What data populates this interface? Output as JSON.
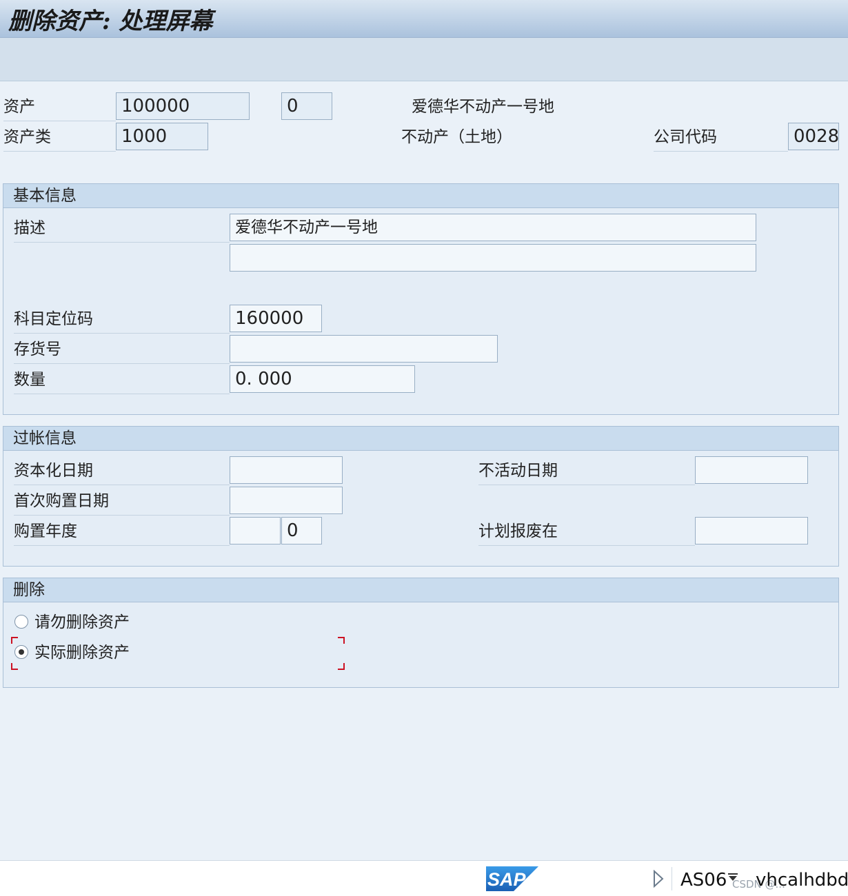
{
  "window": {
    "title": "删除资产: 处理屏幕"
  },
  "header": {
    "asset_label": "资产",
    "asset_number": "100000",
    "asset_subnumber": "0",
    "asset_description": "爱德华不动产一号地",
    "asset_class_label": "资产类",
    "asset_class": "1000",
    "asset_class_description": "不动产（土地）",
    "company_code_label": "公司代码",
    "company_code": "0028"
  },
  "basic_info": {
    "title": "基本信息",
    "description_label": "描述",
    "description_line1": "爱德华不动产一号地",
    "description_line2": "",
    "account_determination_label": "科目定位码",
    "account_determination": "160000",
    "inventory_number_label": "存货号",
    "inventory_number": "",
    "quantity_label": "数量",
    "quantity": "0. 000"
  },
  "posting_info": {
    "title": "过帐信息",
    "capitalization_date_label": "资本化日期",
    "capitalization_date": "",
    "first_acquisition_label": "首次购置日期",
    "first_acquisition": "",
    "acquisition_year_label": "购置年度",
    "acquisition_year": "",
    "acquisition_period": "0",
    "deactivation_date_label": "不活动日期",
    "deactivation_date": "",
    "planned_retirement_label": "计划报废在",
    "planned_retirement": ""
  },
  "deletion": {
    "title": "删除",
    "options": [
      {
        "label": "请勿删除资产",
        "selected": false
      },
      {
        "label": "实际删除资产",
        "selected": true
      }
    ]
  },
  "statusbar": {
    "logo_text": "SAP",
    "transaction": "AS06",
    "server": "vhcalhdbdb",
    "watermark": "CSDN @..."
  },
  "colors": {
    "focus": "#cc1122",
    "sap_blue": "#1f6fc5"
  }
}
